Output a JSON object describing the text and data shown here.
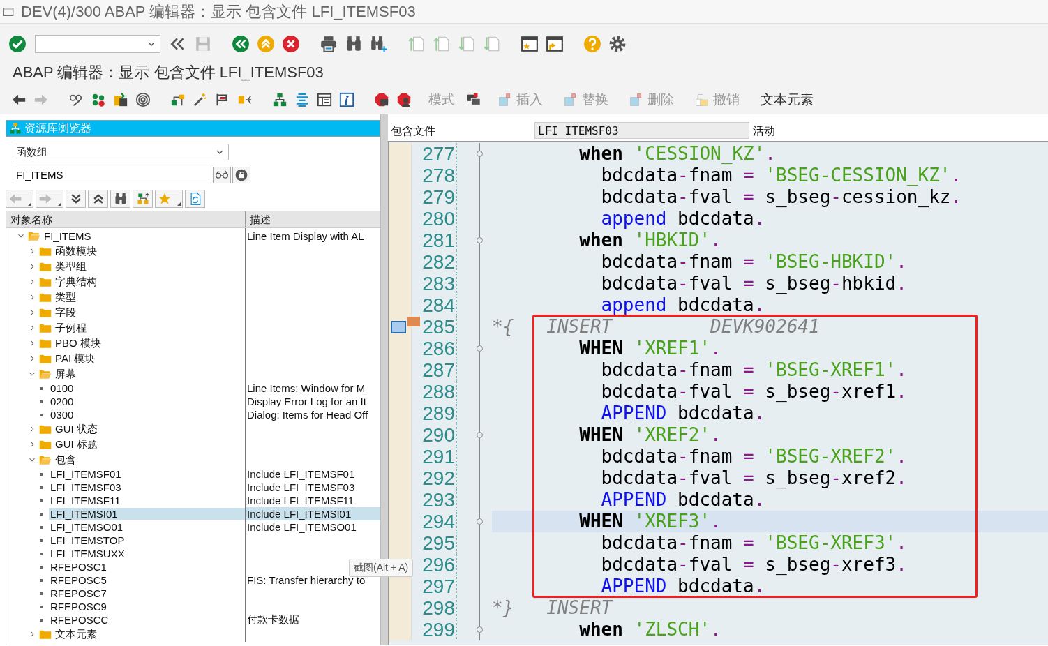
{
  "window": {
    "title": "DEV(4)/300 ABAP 编辑器：显示 包含文件 LFI_ITEMSF03"
  },
  "screen_title": "ABAP 编辑器：显示 包含文件 LFI_ITEMSF03",
  "app_toolbar": {
    "buttons": [
      {
        "label": "模式",
        "kind": "plain",
        "disabled": true
      },
      {
        "label": "插入",
        "kind": "marked",
        "disabled": true
      },
      {
        "label": "替换",
        "kind": "marked",
        "disabled": true
      },
      {
        "label": "删除",
        "kind": "marked",
        "disabled": true
      },
      {
        "label": "撤销",
        "kind": "restore",
        "disabled": true
      },
      {
        "label": "文本元素",
        "kind": "plain",
        "disabled": false
      }
    ]
  },
  "repository_browser": {
    "title": "资源库浏览器",
    "object_type": "函数组",
    "object_name": "FI_ITEMS",
    "columns": [
      "对象名称",
      "描述"
    ],
    "tree": [
      {
        "label": "FI_ITEMS",
        "description": "Line Item Display with AL",
        "kind": "folder",
        "expanded": true,
        "selected": false,
        "children": [
          {
            "label": "函数模块",
            "kind": "folder",
            "expanded": false,
            "selected": false
          },
          {
            "label": "类型组",
            "kind": "folder",
            "expanded": false,
            "selected": false
          },
          {
            "label": "字典结构",
            "kind": "folder",
            "expanded": false,
            "selected": false
          },
          {
            "label": "类型",
            "kind": "folder",
            "expanded": false,
            "selected": false
          },
          {
            "label": "字段",
            "kind": "folder",
            "expanded": false,
            "selected": false
          },
          {
            "label": "子例程",
            "kind": "folder",
            "expanded": false,
            "selected": false
          },
          {
            "label": "PBO 模块",
            "kind": "folder",
            "expanded": false,
            "selected": false
          },
          {
            "label": "PAI 模块",
            "kind": "folder",
            "expanded": false,
            "selected": false
          },
          {
            "label": "屏幕",
            "kind": "folder",
            "expanded": true,
            "selected": false,
            "children": [
              {
                "label": "0100",
                "description": "Line Items: Window for M",
                "kind": "object",
                "selected": false
              },
              {
                "label": "0200",
                "description": "Display Error Log for an It",
                "kind": "object",
                "selected": false
              },
              {
                "label": "0300",
                "description": "Dialog: Items for Head Off",
                "kind": "object",
                "selected": false
              }
            ]
          },
          {
            "label": "GUI 状态",
            "kind": "folder",
            "expanded": false,
            "selected": false
          },
          {
            "label": "GUI 标题",
            "kind": "folder",
            "expanded": false,
            "selected": false
          },
          {
            "label": "包含",
            "kind": "folder",
            "expanded": true,
            "selected": false,
            "children": [
              {
                "label": "LFI_ITEMSF01",
                "description": "Include LFI_ITEMSF01",
                "kind": "object",
                "selected": false
              },
              {
                "label": "LFI_ITEMSF03",
                "description": "Include LFI_ITEMSF03",
                "kind": "object",
                "selected": false
              },
              {
                "label": "LFI_ITEMSF11",
                "description": "Include LFI_ITEMSF11",
                "kind": "object",
                "selected": false
              },
              {
                "label": "LFI_ITEMSI01",
                "description": "Include LFI_ITEMSI01",
                "kind": "object",
                "selected": true
              },
              {
                "label": "LFI_ITEMSO01",
                "description": "Include LFI_ITEMSO01",
                "kind": "object",
                "selected": false
              },
              {
                "label": "LFI_ITEMSTOP",
                "kind": "object",
                "selected": false
              },
              {
                "label": "LFI_ITEMSUXX",
                "kind": "object",
                "selected": false
              },
              {
                "label": "RFEPOSC1",
                "kind": "object",
                "selected": false
              },
              {
                "label": "RFEPOSC5",
                "description": "FIS: Transfer hierarchy to",
                "kind": "object",
                "selected": false
              },
              {
                "label": "RFEPOSC7",
                "kind": "object",
                "selected": false
              },
              {
                "label": "RFEPOSC9",
                "kind": "object",
                "selected": false
              },
              {
                "label": "RFEPOSCC",
                "description": "付款卡数据",
                "kind": "object",
                "selected": false
              }
            ]
          },
          {
            "label": "文本元素",
            "kind": "folder",
            "expanded": false,
            "selected": false
          }
        ]
      }
    ]
  },
  "editor": {
    "object_label": "包含文件",
    "object_name": "LFI_ITEMSF03",
    "status": "活动",
    "lines": [
      {
        "number": "277",
        "fold": true,
        "bookmark": false,
        "current": false,
        "tokens": [
          {
            "kind": "keyword",
            "text": "        when"
          },
          {
            "kind": "string",
            "text": " 'CESSION_KZ'"
          },
          {
            "kind": "operator",
            "text": "."
          }
        ]
      },
      {
        "number": "278",
        "fold": false,
        "bookmark": false,
        "current": false,
        "tokens": [
          {
            "kind": "name",
            "text": "          bdcdata"
          },
          {
            "kind": "operator",
            "text": "-"
          },
          {
            "kind": "name",
            "text": "fnam"
          },
          {
            "kind": "operator",
            "text": " = "
          },
          {
            "kind": "string",
            "text": "'BSEG-CESSION_KZ'"
          },
          {
            "kind": "operator",
            "text": "."
          }
        ]
      },
      {
        "number": "279",
        "fold": false,
        "bookmark": false,
        "current": false,
        "tokens": [
          {
            "kind": "name",
            "text": "          bdcdata"
          },
          {
            "kind": "operator",
            "text": "-"
          },
          {
            "kind": "name",
            "text": "fval"
          },
          {
            "kind": "operator",
            "text": " = "
          },
          {
            "kind": "name",
            "text": "s_bseg"
          },
          {
            "kind": "operator",
            "text": "-"
          },
          {
            "kind": "name",
            "text": "cession_kz"
          },
          {
            "kind": "operator",
            "text": "."
          }
        ]
      },
      {
        "number": "280",
        "fold": false,
        "bookmark": false,
        "current": false,
        "tokens": [
          {
            "kind": "statement",
            "text": "          append"
          },
          {
            "kind": "name",
            "text": " bdcdata"
          },
          {
            "kind": "operator",
            "text": "."
          }
        ]
      },
      {
        "number": "281",
        "fold": true,
        "bookmark": false,
        "current": false,
        "tokens": [
          {
            "kind": "keyword",
            "text": "        when"
          },
          {
            "kind": "string",
            "text": " 'HBKID'"
          },
          {
            "kind": "operator",
            "text": "."
          }
        ]
      },
      {
        "number": "282",
        "fold": false,
        "bookmark": false,
        "current": false,
        "tokens": [
          {
            "kind": "name",
            "text": "          bdcdata"
          },
          {
            "kind": "operator",
            "text": "-"
          },
          {
            "kind": "name",
            "text": "fnam"
          },
          {
            "kind": "operator",
            "text": " = "
          },
          {
            "kind": "string",
            "text": "'BSEG-HBKID'"
          },
          {
            "kind": "operator",
            "text": "."
          }
        ]
      },
      {
        "number": "283",
        "fold": false,
        "bookmark": false,
        "current": false,
        "tokens": [
          {
            "kind": "name",
            "text": "          bdcdata"
          },
          {
            "kind": "operator",
            "text": "-"
          },
          {
            "kind": "name",
            "text": "fval"
          },
          {
            "kind": "operator",
            "text": " = "
          },
          {
            "kind": "name",
            "text": "s_bseg"
          },
          {
            "kind": "operator",
            "text": "-"
          },
          {
            "kind": "name",
            "text": "hbkid"
          },
          {
            "kind": "operator",
            "text": "."
          }
        ]
      },
      {
        "number": "284",
        "fold": false,
        "bookmark": false,
        "current": false,
        "tokens": [
          {
            "kind": "statement",
            "text": "          append"
          },
          {
            "kind": "name",
            "text": " bdcdata"
          },
          {
            "kind": "operator",
            "text": "."
          }
        ]
      },
      {
        "number": "285",
        "fold": false,
        "bookmark": true,
        "current": false,
        "tokens": [
          {
            "kind": "comment",
            "text": "*{   INSERT         DEVK902641"
          }
        ]
      },
      {
        "number": "286",
        "fold": true,
        "bookmark": false,
        "current": false,
        "tokens": [
          {
            "kind": "keyword",
            "text": "        WHEN"
          },
          {
            "kind": "string",
            "text": " 'XREF1'"
          },
          {
            "kind": "operator",
            "text": "."
          }
        ]
      },
      {
        "number": "287",
        "fold": false,
        "bookmark": false,
        "current": false,
        "tokens": [
          {
            "kind": "name",
            "text": "          bdcdata"
          },
          {
            "kind": "operator",
            "text": "-"
          },
          {
            "kind": "name",
            "text": "fnam"
          },
          {
            "kind": "operator",
            "text": " = "
          },
          {
            "kind": "string",
            "text": "'BSEG-XREF1'"
          },
          {
            "kind": "operator",
            "text": "."
          }
        ]
      },
      {
        "number": "288",
        "fold": false,
        "bookmark": false,
        "current": false,
        "tokens": [
          {
            "kind": "name",
            "text": "          bdcdata"
          },
          {
            "kind": "operator",
            "text": "-"
          },
          {
            "kind": "name",
            "text": "fval"
          },
          {
            "kind": "operator",
            "text": " = "
          },
          {
            "kind": "name",
            "text": "s_bseg"
          },
          {
            "kind": "operator",
            "text": "-"
          },
          {
            "kind": "name",
            "text": "xref1"
          },
          {
            "kind": "operator",
            "text": "."
          }
        ]
      },
      {
        "number": "289",
        "fold": false,
        "bookmark": false,
        "current": false,
        "tokens": [
          {
            "kind": "statement",
            "text": "          APPEND"
          },
          {
            "kind": "name",
            "text": " bdcdata"
          },
          {
            "kind": "operator",
            "text": "."
          }
        ]
      },
      {
        "number": "290",
        "fold": true,
        "bookmark": false,
        "current": false,
        "tokens": [
          {
            "kind": "keyword",
            "text": "        WHEN"
          },
          {
            "kind": "string",
            "text": " 'XREF2'"
          },
          {
            "kind": "operator",
            "text": "."
          }
        ]
      },
      {
        "number": "291",
        "fold": false,
        "bookmark": false,
        "current": false,
        "tokens": [
          {
            "kind": "name",
            "text": "          bdcdata"
          },
          {
            "kind": "operator",
            "text": "-"
          },
          {
            "kind": "name",
            "text": "fnam"
          },
          {
            "kind": "operator",
            "text": " = "
          },
          {
            "kind": "string",
            "text": "'BSEG-XREF2'"
          },
          {
            "kind": "operator",
            "text": "."
          }
        ]
      },
      {
        "number": "292",
        "fold": false,
        "bookmark": false,
        "current": false,
        "tokens": [
          {
            "kind": "name",
            "text": "          bdcdata"
          },
          {
            "kind": "operator",
            "text": "-"
          },
          {
            "kind": "name",
            "text": "fval"
          },
          {
            "kind": "operator",
            "text": " = "
          },
          {
            "kind": "name",
            "text": "s_bseg"
          },
          {
            "kind": "operator",
            "text": "-"
          },
          {
            "kind": "name",
            "text": "xref2"
          },
          {
            "kind": "operator",
            "text": "."
          }
        ]
      },
      {
        "number": "293",
        "fold": false,
        "bookmark": false,
        "current": false,
        "tokens": [
          {
            "kind": "statement",
            "text": "          APPEND"
          },
          {
            "kind": "name",
            "text": " bdcdata"
          },
          {
            "kind": "operator",
            "text": "."
          }
        ]
      },
      {
        "number": "294",
        "fold": true,
        "bookmark": false,
        "current": true,
        "tokens": [
          {
            "kind": "keyword",
            "text": "        WHEN"
          },
          {
            "kind": "string",
            "text": " 'XREF3'"
          },
          {
            "kind": "operator",
            "text": "."
          }
        ]
      },
      {
        "number": "295",
        "fold": false,
        "bookmark": false,
        "current": false,
        "tokens": [
          {
            "kind": "name",
            "text": "          bdcdata"
          },
          {
            "kind": "operator",
            "text": "-"
          },
          {
            "kind": "name",
            "text": "fnam"
          },
          {
            "kind": "operator",
            "text": " = "
          },
          {
            "kind": "string",
            "text": "'BSEG-XREF3'"
          },
          {
            "kind": "operator",
            "text": "."
          }
        ]
      },
      {
        "number": "296",
        "fold": false,
        "bookmark": false,
        "current": false,
        "tokens": [
          {
            "kind": "name",
            "text": "          bdcdata"
          },
          {
            "kind": "operator",
            "text": "-"
          },
          {
            "kind": "name",
            "text": "fval"
          },
          {
            "kind": "operator",
            "text": " = "
          },
          {
            "kind": "name",
            "text": "s_bseg"
          },
          {
            "kind": "operator",
            "text": "-"
          },
          {
            "kind": "name",
            "text": "xref3"
          },
          {
            "kind": "operator",
            "text": "."
          }
        ]
      },
      {
        "number": "297",
        "fold": false,
        "bookmark": false,
        "current": false,
        "tokens": [
          {
            "kind": "statement",
            "text": "          APPEND"
          },
          {
            "kind": "name",
            "text": " bdcdata"
          },
          {
            "kind": "operator",
            "text": "."
          }
        ]
      },
      {
        "number": "298",
        "fold": false,
        "bookmark": false,
        "current": false,
        "tokens": [
          {
            "kind": "comment",
            "text": "*}   INSERT"
          }
        ]
      },
      {
        "number": "299",
        "fold": true,
        "bookmark": false,
        "current": false,
        "tokens": [
          {
            "kind": "keyword",
            "text": "        when"
          },
          {
            "kind": "string",
            "text": " 'ZLSCH'"
          },
          {
            "kind": "operator",
            "text": "."
          }
        ]
      }
    ]
  },
  "tooltip": {
    "text": "截图(Alt + A)"
  }
}
